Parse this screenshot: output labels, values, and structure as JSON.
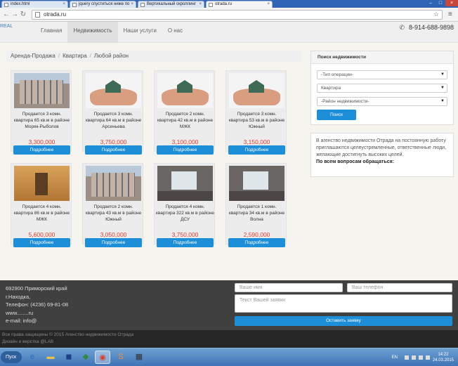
{
  "browser": {
    "tabs": [
      {
        "title": "index.html",
        "active": false
      },
      {
        "title": "jquery спуститься ниже по",
        "active": false
      },
      {
        "title": "Вертикальный скроллинг",
        "active": false
      },
      {
        "title": "otrada.ru",
        "active": true
      }
    ],
    "url": "otrada.ru"
  },
  "site": {
    "logo": "REAL",
    "nav": [
      "Главная",
      "Недвижимость",
      "Наши услуги",
      "О нас"
    ],
    "phone": "8-914-688-9898"
  },
  "breadcrumb": [
    "Аренда-Продажа",
    "Квартира",
    "Любой район"
  ],
  "listings": [
    {
      "desc": "Продается 3 комн. квартира 65 кв.м в районе Моряк-Рыболов",
      "price": "3,300,000",
      "photo": "building",
      "button": "Подробнее"
    },
    {
      "desc": "Продается 3 комн. квартира 64 кв.м в районе Арсеньева",
      "price": "3,750,000",
      "photo": "hands",
      "button": "Подробнее"
    },
    {
      "desc": "Продается 2 комн. квартира 42 кв.м в районе МЖК",
      "price": "3,100,000",
      "photo": "hands",
      "button": "Подробнее"
    },
    {
      "desc": "Продается 3 комн. квартира 53 кв.м в районе Южный",
      "price": "3,150,000",
      "photo": "hands",
      "button": "Подробнее"
    },
    {
      "desc": "Продается 4 комн. квартира 86 кв.м в районе МЖК",
      "price": "5,600,000",
      "photo": "hall",
      "button": "Подробнее"
    },
    {
      "desc": "Продается 2 комн. квартира 43 кв.м в районе Южный",
      "price": "3,050,000",
      "photo": "building",
      "button": "Подробнее"
    },
    {
      "desc": "Продается 4 комн. квартира 322 кв.м в районе ДСУ",
      "price": "3,750,000",
      "photo": "room",
      "button": "Подробнее"
    },
    {
      "desc": "Продается 1 комн. квартира 34 кв.м в районе Волна",
      "price": "2,590,000",
      "photo": "room",
      "button": "Подробнее"
    }
  ],
  "search": {
    "title": "Поиск недвижимости",
    "operation": "-Тип операции-",
    "type": "Квартира",
    "district": "-Район недвижимости-",
    "button": "Поиск"
  },
  "info": {
    "text": "В агенство недвижимости Отрада на постоянную работу приглашаются целеустремленные, ответственные люди, желающие достигнуть высоких целей.",
    "contact": "По всем вопросам обращаться:"
  },
  "footer": {
    "address": "692900 Приморский край",
    "city": "г.Находка,",
    "phone": "Телефон: (4236) 69-81-08",
    "www": "www........ru",
    "email": "e-mail: info@",
    "name_placeholder": "Ваше имя",
    "phone_placeholder": "Ваш телефон",
    "request_placeholder": "Текст Вашей заявки",
    "submit": "Оставить заявку",
    "copyright": "Все права защищены © 2015 Агенство недвижимости Отрада",
    "design": "Дизайн и верстка @LAB"
  },
  "taskbar": {
    "start": "Пуск",
    "lang": "EN",
    "time": "14:22",
    "date": "24.03.2015"
  }
}
